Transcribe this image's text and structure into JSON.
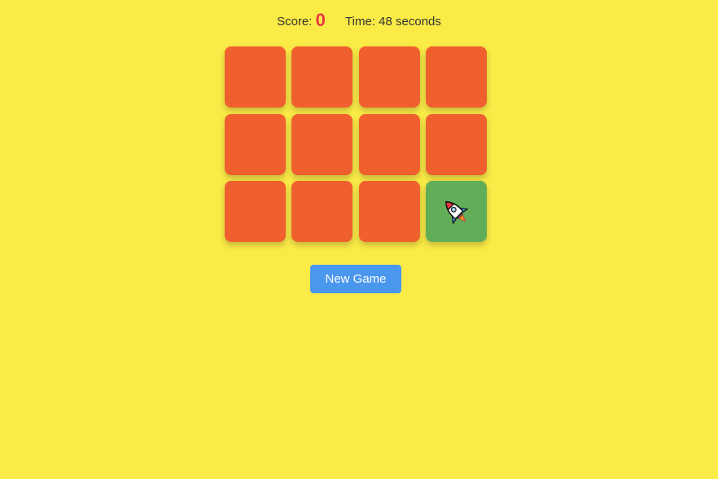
{
  "status": {
    "score_label": "Score:",
    "score_value": "0",
    "time_text": "Time: 48 seconds"
  },
  "board": {
    "rows": 3,
    "columns": 4,
    "cards": [
      {
        "face_up": false,
        "icon": ""
      },
      {
        "face_up": false,
        "icon": ""
      },
      {
        "face_up": false,
        "icon": ""
      },
      {
        "face_up": false,
        "icon": ""
      },
      {
        "face_up": false,
        "icon": ""
      },
      {
        "face_up": false,
        "icon": ""
      },
      {
        "face_up": false,
        "icon": ""
      },
      {
        "face_up": false,
        "icon": ""
      },
      {
        "face_up": false,
        "icon": ""
      },
      {
        "face_up": false,
        "icon": ""
      },
      {
        "face_up": false,
        "icon": ""
      },
      {
        "face_up": true,
        "icon": "rocket-icon"
      }
    ]
  },
  "controls": {
    "new_game_label": "New Game"
  },
  "colors": {
    "background": "#FBEB47",
    "card_back": "#F05F2E",
    "card_face": "#62AE58",
    "score_value": "#E8343F",
    "button": "#4A97EE"
  }
}
